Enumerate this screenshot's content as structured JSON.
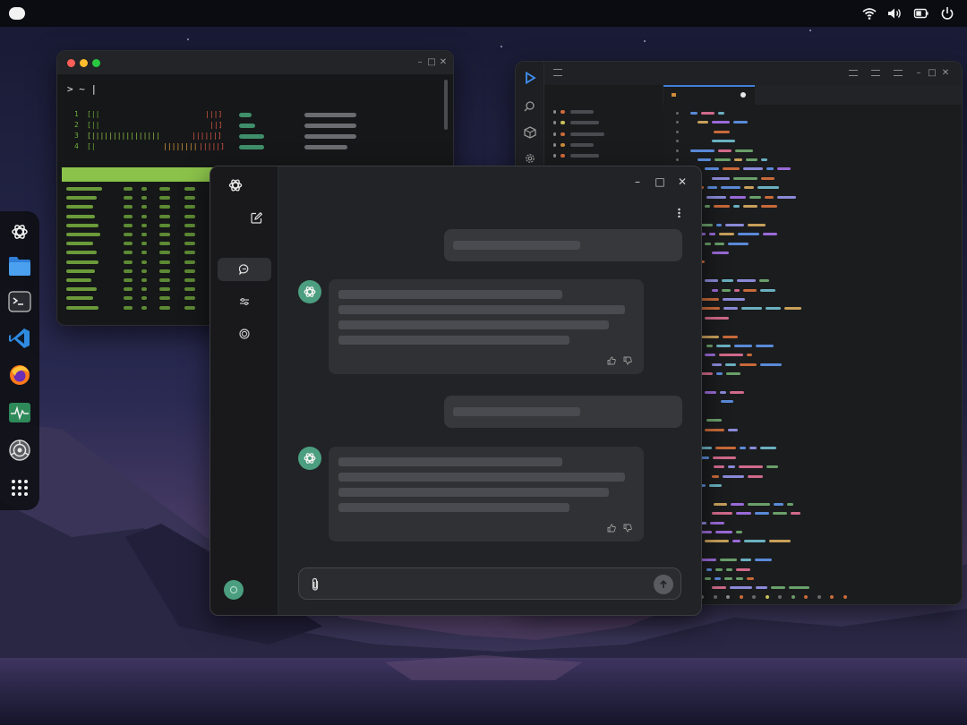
{
  "terminal": {
    "prompt": "> ~ |",
    "cpus": [
      "1",
      "2",
      "3",
      "4"
    ]
  },
  "chat": {
    "composer_placeholder": ""
  },
  "colors": {
    "accent_green": "#4b9e7f",
    "terminal_green": "#8bc34a",
    "editor_accent": "#3f7fd9"
  },
  "icons": {
    "dock": [
      "chatgpt-icon",
      "files-icon",
      "terminal-icon",
      "vscode-icon",
      "firefox-icon",
      "system-monitor-icon",
      "settings-icon",
      "app-grid-icon"
    ],
    "tray": [
      "wifi-icon",
      "volume-icon",
      "battery-icon",
      "power-icon"
    ]
  }
}
